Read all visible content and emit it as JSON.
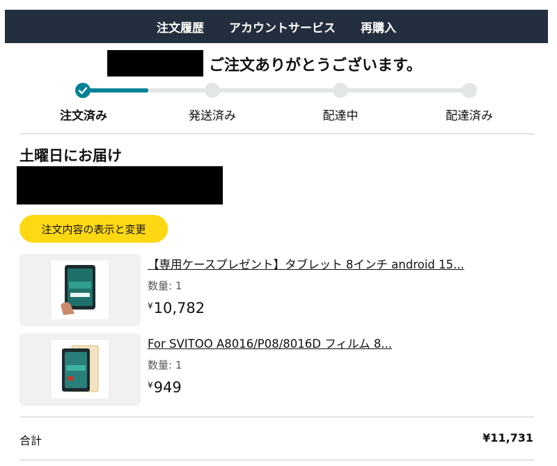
{
  "nav": {
    "items": [
      "注文履歴",
      "アカウントサービス",
      "再購入"
    ]
  },
  "header": {
    "thanks_text": "ご注文ありがとうございます。"
  },
  "progress": {
    "steps": [
      {
        "label": "注文済み",
        "state": "done"
      },
      {
        "label": "発送済み",
        "state": "pending"
      },
      {
        "label": "配達中",
        "state": "pending"
      },
      {
        "label": "配達済み",
        "state": "pending"
      }
    ],
    "completed_fraction": 0.17
  },
  "delivery": {
    "date_text": "土曜日にお届け"
  },
  "actions": {
    "view_edit_label": "注文内容の表示と変更"
  },
  "items": [
    {
      "title": "【専用ケースプレゼント】タブレット 8インチ android 15...",
      "qty_label": "数量: 1",
      "currency": "¥",
      "price": "10,782",
      "thumb_icon": "tablet-product-image"
    },
    {
      "title": "For SVITOO A8016/P08/8016D フィルム 8...",
      "qty_label": "数量: 1",
      "currency": "¥",
      "price": "949",
      "thumb_icon": "screen-film-product-image"
    }
  ],
  "summary": {
    "total_label": "合計",
    "total_value": "¥11,731"
  },
  "colors": {
    "nav_bg": "#232f3e",
    "progress_active": "#008296",
    "progress_inactive": "#e3e6e6",
    "button_yellow": "#ffd814"
  }
}
